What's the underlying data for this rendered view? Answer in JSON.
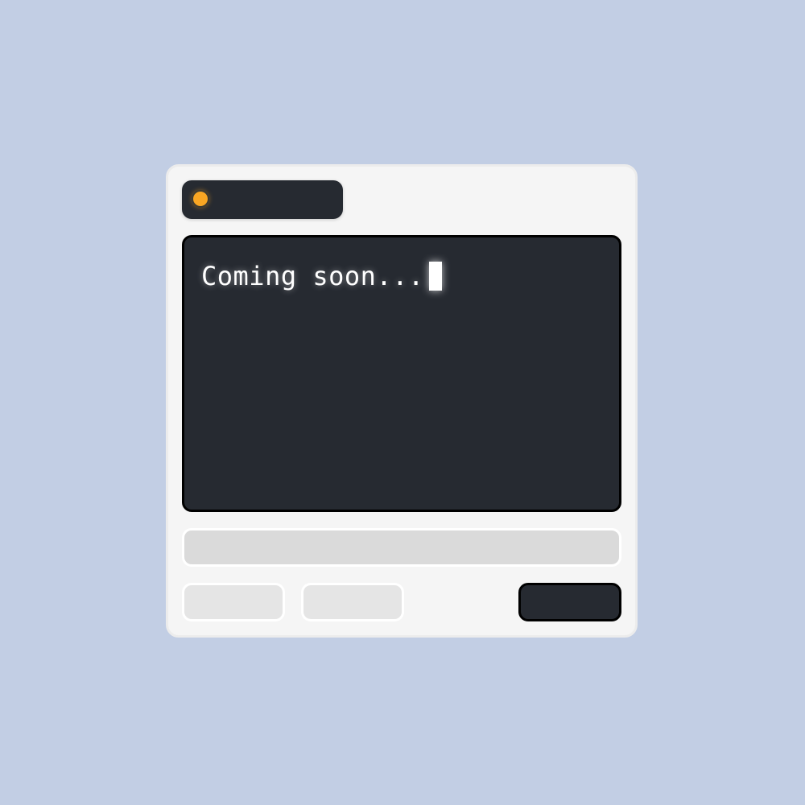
{
  "terminal": {
    "text": "Coming soon..."
  },
  "icons": {
    "status": "status-dot-icon"
  },
  "colors": {
    "background": "#c2cee4",
    "window": "#f5f5f5",
    "dark": "#262a31",
    "status_dot": "#f9a623",
    "terminal_text": "#ffffff"
  }
}
